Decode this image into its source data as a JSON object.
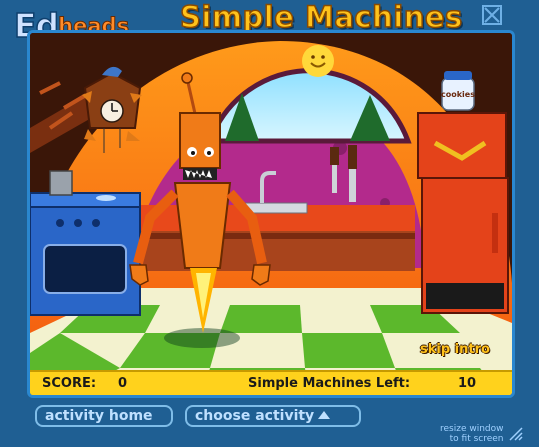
{
  "header": {
    "logo_ed": "Ed",
    "logo_heads": "heads",
    "title": "Simple Machines"
  },
  "scene": {
    "cookie_jar_label": "cookies"
  },
  "game": {
    "skip_intro": "skip intro",
    "score_label": "SCORE:",
    "score_value": "0",
    "machines_left_label": "Simple Machines Left:",
    "machines_left_value": "10"
  },
  "footer": {
    "activity_home": "activity home",
    "choose_activity": "choose activity",
    "resize_line1": "resize window",
    "resize_line2": "to fit screen"
  },
  "colors": {
    "page_bg": "#1f5f93",
    "title_yellow": "#ffc21b",
    "status_bar": "#ffd21c",
    "robot_orange": "#f07b18"
  }
}
